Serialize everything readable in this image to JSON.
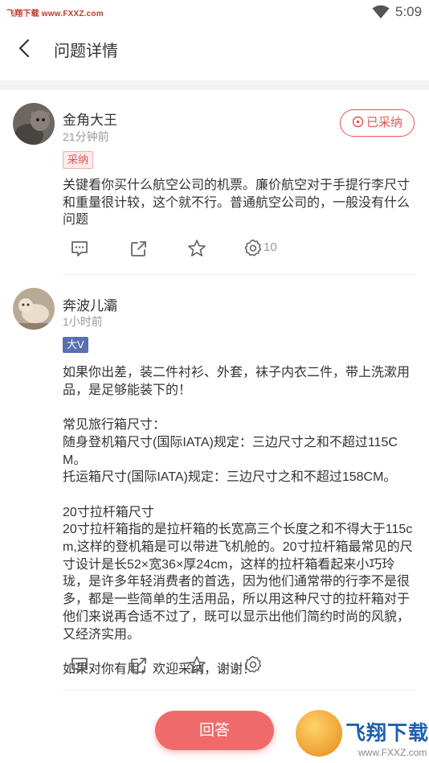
{
  "status_bar": {
    "watermark": "飞翔下载 www.FXXZ.com",
    "time": "5:09"
  },
  "nav": {
    "title": "问题详情"
  },
  "answers": [
    {
      "author": "金角大王",
      "time": "21分钟前",
      "tag": "采纳",
      "adopted_label": "已采纳",
      "content": "关键看你买什么航空公司的机票。廉价航空对于手提行李尺寸和重量很计较，这个就不行。普通航空公司的，一般没有什么问题",
      "settings_count": "10"
    },
    {
      "author": "奔波儿灞",
      "time": "1小时前",
      "tag": "大V",
      "content": "如果你出差，装二件衬衫、外套，袜子内衣二件，带上洗漱用品，是足够能装下的！\n\n常见旅行箱尺寸：\n随身登机箱尺寸(国际IATA)规定：三边尺寸之和不超过115CM。\n托运箱尺寸(国际IATA)规定：三边尺寸之和不超过158CM。\n\n20寸拉杆箱尺寸\n20寸拉杆箱指的是拉杆箱的长宽高三个长度之和不得大于115cm,这样的登机箱是可以带进飞机舱的。20寸拉杆箱最常见的尺寸设计是长52×宽36×厚24cm，这样的拉杆箱看起来小巧玲珑，是许多年轻消费者的首选，因为他们通常带的行李不是很多，都是一些简单的生活用品，所以用这种尺寸的拉杆箱对于他们来说再合适不过了，既可以显示出他们简约时尚的风貌，又经济实用。\n\n如果对你有用，欢迎采纳，谢谢！"
    }
  ],
  "footer": {
    "answer_label": "回答",
    "logo_text": "飞翔下载",
    "logo_url": "www.FXXZ.com"
  },
  "colors": {
    "accent": "#ef6b6b",
    "adopt_red": "#e15555",
    "bigv_badge": "#5a6fb0"
  },
  "icons": [
    "back-arrow-icon",
    "wifi-icon",
    "comment-icon",
    "share-icon",
    "star-icon",
    "gear-icon",
    "clock-icon"
  ]
}
